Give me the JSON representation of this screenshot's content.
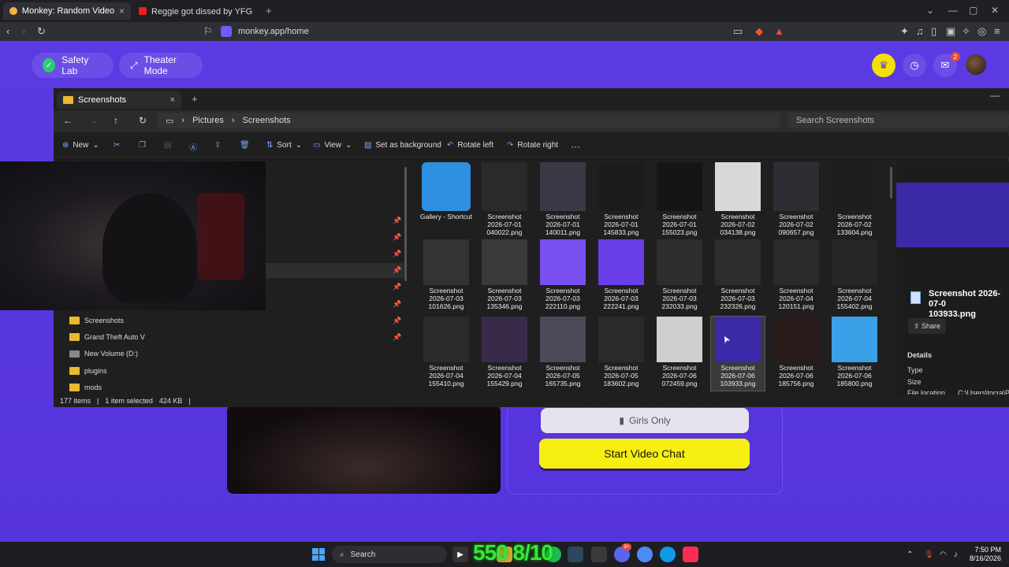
{
  "browser": {
    "tabs": [
      {
        "title": "Monkey: Random Video Chat",
        "active": true
      },
      {
        "title": "Reggie got dissed by YFG Fatso 😂😂",
        "active": false
      }
    ],
    "new_tab": "+",
    "url": "monkey.app/home"
  },
  "monkey": {
    "safety_lab": "Safety Lab",
    "theater_mode": "Theater Mode",
    "notif_count": "2",
    "girls_only": "Girls Only",
    "start_video_chat": "Start Video Chat",
    "colors": {
      "bg": "#5a3be0",
      "accent": "#f7ef12"
    }
  },
  "explorer": {
    "tab_title": "Screenshots",
    "breadcrumb": [
      "Pictures",
      "Screenshots"
    ],
    "search_placeholder": "Search Screenshots",
    "commands": {
      "new": "New",
      "sort": "Sort",
      "view": "View",
      "set_bg": "Set as background",
      "rotate_left": "Rotate left",
      "rotate_right": "Rotate right",
      "more": "···"
    },
    "nav_items": [
      {
        "label": "Screenshots"
      },
      {
        "label": "Grand Theft Auto V"
      },
      {
        "label": "New Volume (D:)"
      },
      {
        "label": "plugins"
      },
      {
        "label": "mods"
      }
    ],
    "files": [
      {
        "line1": "Gallery - Shortcut",
        "line2": "",
        "line3": ""
      },
      {
        "line1": "Screenshot",
        "line2": "2026-07-01",
        "line3": "040022.png"
      },
      {
        "line1": "Screenshot",
        "line2": "2026-07-01",
        "line3": "140011.png"
      },
      {
        "line1": "Screenshot",
        "line2": "2026-07-01",
        "line3": "145833.png"
      },
      {
        "line1": "Screenshot",
        "line2": "2026-07-01",
        "line3": "155023.png"
      },
      {
        "line1": "Screenshot",
        "line2": "2026-07-02",
        "line3": "034138.png"
      },
      {
        "line1": "Screenshot",
        "line2": "2026-07-02",
        "line3": "090657.png"
      },
      {
        "line1": "Screenshot",
        "line2": "2026-07-02",
        "line3": "133604.png"
      },
      {
        "line1": "Screenshot",
        "line2": "2026-07-03",
        "line3": "101626.png"
      },
      {
        "line1": "Screenshot",
        "line2": "2026-07-03",
        "line3": "135346.png"
      },
      {
        "line1": "Screenshot",
        "line2": "2026-07-03",
        "line3": "222110.png"
      },
      {
        "line1": "Screenshot",
        "line2": "2026-07-03",
        "line3": "222241.png"
      },
      {
        "line1": "Screenshot",
        "line2": "2026-07-03",
        "line3": "232033.png"
      },
      {
        "line1": "Screenshot",
        "line2": "2026-07-03",
        "line3": "232326.png"
      },
      {
        "line1": "Screenshot",
        "line2": "2026-07-04",
        "line3": "120151.png"
      },
      {
        "line1": "Screenshot",
        "line2": "2026-07-04",
        "line3": "155402.png"
      },
      {
        "line1": "Screenshot",
        "line2": "2026-07-04",
        "line3": "155410.png"
      },
      {
        "line1": "Screenshot",
        "line2": "2026-07-04",
        "line3": "155429.png"
      },
      {
        "line1": "Screenshot",
        "line2": "2026-07-05",
        "line3": "165735.png"
      },
      {
        "line1": "Screenshot",
        "line2": "2026-07-05",
        "line3": "183602.png"
      },
      {
        "line1": "Screenshot",
        "line2": "2026-07-06",
        "line3": "072459.png"
      },
      {
        "line1": "Screenshot",
        "line2": "2026-07-06",
        "line3": "103933.png"
      },
      {
        "line1": "Screenshot",
        "line2": "2026-07-06",
        "line3": "185756.png"
      },
      {
        "line1": "Screenshot",
        "line2": "2026-07-06",
        "line3": "185800.png"
      }
    ],
    "details": {
      "name_line1": "Screenshot 2026-07-0",
      "name_line2": "103933.png",
      "share": "Share",
      "heading": "Details",
      "type_label": "Type",
      "size_label": "Size",
      "location_label": "File location",
      "location_value": "C:\\Users\\tocra\\Pic"
    },
    "status": {
      "count": "177 items",
      "selected": "1 item selected",
      "size": "424 KB"
    }
  },
  "taskbar": {
    "search": "Search",
    "overlay_text": "550 8/10",
    "time": "7:50 PM",
    "date": "8/16/2026",
    "badge": "9+"
  }
}
